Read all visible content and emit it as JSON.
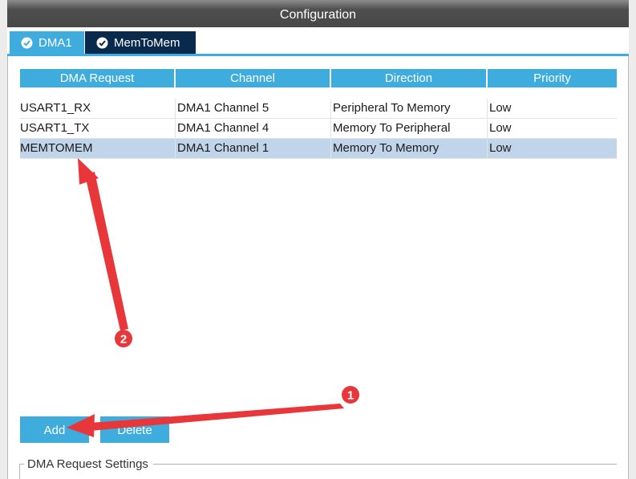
{
  "window": {
    "title": "Configuration"
  },
  "tabs": [
    {
      "label": "DMA1",
      "state": "active",
      "icon": "check-circle-icon"
    },
    {
      "label": "MemToMem",
      "state": "inactive",
      "icon": "check-circle-icon"
    }
  ],
  "table": {
    "headers": [
      "DMA Request",
      "Channel",
      "Direction",
      "Priority"
    ],
    "rows": [
      {
        "request": "USART1_RX",
        "channel": "DMA1 Channel 5",
        "direction": "Peripheral To Memory",
        "priority": "Low",
        "selected": false
      },
      {
        "request": "USART1_TX",
        "channel": "DMA1 Channel 4",
        "direction": "Memory To Peripheral",
        "priority": "Low",
        "selected": false
      },
      {
        "request": "MEMTOMEM",
        "channel": "DMA1 Channel 1",
        "direction": "Memory To Memory",
        "priority": "Low",
        "selected": true
      }
    ]
  },
  "buttons": {
    "add": "Add",
    "delete": "Delete"
  },
  "settings_group": {
    "title": "DMA Request Settings"
  },
  "annotations": [
    {
      "number": "1",
      "color": "#e8373b"
    },
    {
      "number": "2",
      "color": "#e8373b"
    }
  ],
  "colors": {
    "accent": "#3eadde",
    "tab_inactive": "#092a4c",
    "selected_row": "#c0d4ea",
    "annotation": "#e8373b"
  }
}
